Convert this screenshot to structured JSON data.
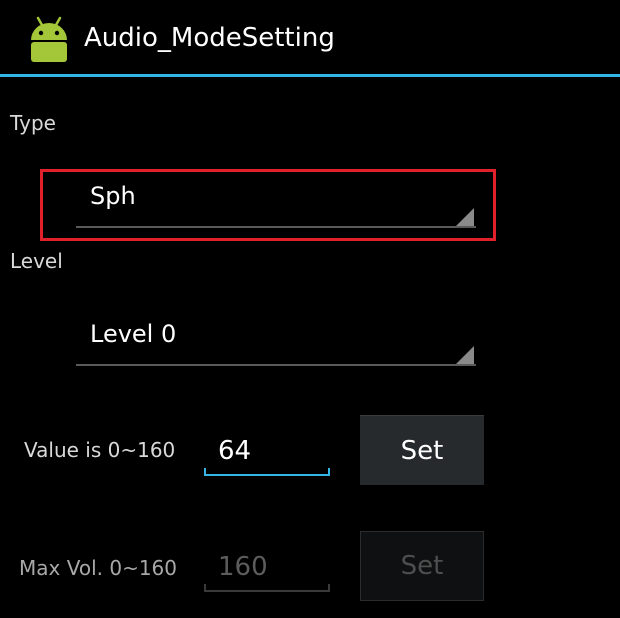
{
  "app": {
    "title": "Audio_ModeSetting",
    "icon": "android-robot-icon",
    "accent_color": "#33b5e5"
  },
  "type_section": {
    "label": "Type",
    "selected": "Sph",
    "highlight_color": "#e0202a"
  },
  "level_section": {
    "label": "Level",
    "selected": "Level 0"
  },
  "value_row": {
    "label": "Value is 0~160",
    "value": "64",
    "button_label": "Set",
    "enabled": true
  },
  "max_vol_row": {
    "label": "Max Vol. 0~160",
    "value": "160",
    "button_label": "Set",
    "enabled": false
  }
}
